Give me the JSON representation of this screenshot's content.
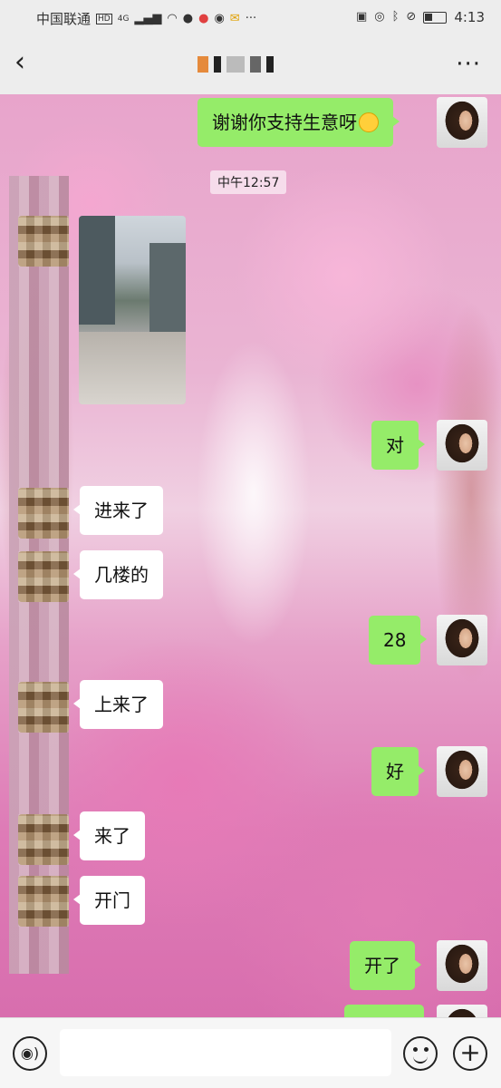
{
  "statusbar": {
    "carrier": "中国联通",
    "network": "4G",
    "hd": "HD",
    "time": "4:13",
    "icons": [
      "signal-icon",
      "wifi-icon",
      "chat-notification-icon",
      "location-icon",
      "wechat-icon",
      "mail-icon",
      "more-notifications-icon",
      "briefcase-icon",
      "eye-icon",
      "bluetooth-icon",
      "mute-icon",
      "battery-icon"
    ],
    "more_dots": "···"
  },
  "header": {
    "back_icon": "chevron-left-icon",
    "back_glyph": "‹",
    "more_glyph": "···",
    "title_obscured": true
  },
  "chat": {
    "timestamp": "中午12:57",
    "messages": [
      {
        "from": "me",
        "text": "谢谢你支持生意呀"
      },
      {
        "from": "them",
        "type": "image"
      },
      {
        "from": "me",
        "text": "对"
      },
      {
        "from": "them",
        "text": "进来了"
      },
      {
        "from": "them",
        "text": "几楼的"
      },
      {
        "from": "me",
        "text": "28"
      },
      {
        "from": "them",
        "text": "上来了"
      },
      {
        "from": "me",
        "text": "好"
      },
      {
        "from": "them",
        "text": "来了"
      },
      {
        "from": "them",
        "text": "开门"
      },
      {
        "from": "me",
        "text": "开了"
      }
    ]
  },
  "inputbar": {
    "voice_glyph": "◉)",
    "plus_glyph": "+"
  },
  "colors": {
    "my_bubble": "#95ec69",
    "their_bubble": "#ffffff",
    "bar_bg": "#ededed"
  }
}
